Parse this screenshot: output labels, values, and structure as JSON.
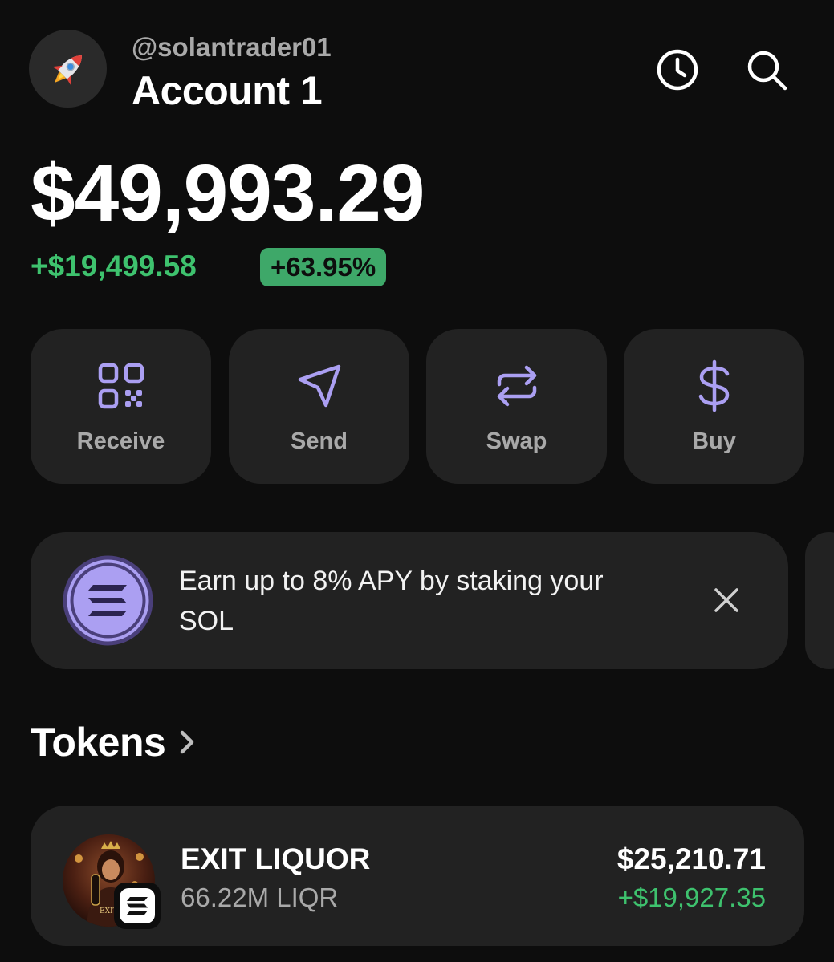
{
  "account": {
    "username": "@solantrader01",
    "name": "Account 1",
    "avatar_icon": "rocket-icon"
  },
  "header_icons": [
    "history-clock-icon",
    "search-icon"
  ],
  "balance": {
    "total": "$49,993.29",
    "change_amount": "+$19,499.58",
    "change_percent": "+63.95%"
  },
  "actions": [
    {
      "label": "Receive",
      "icon": "qr-code-icon"
    },
    {
      "label": "Send",
      "icon": "send-arrow-icon"
    },
    {
      "label": "Swap",
      "icon": "swap-arrows-icon"
    },
    {
      "label": "Buy",
      "icon": "dollar-icon"
    }
  ],
  "promo": {
    "text": "Earn up to 8% APY by staking your SOL",
    "icon": "solana-logo-icon"
  },
  "tokens": {
    "title": "Tokens",
    "items": [
      {
        "name": "EXIT LIQUOR",
        "amount": "66.22M LIQR",
        "value": "$25,210.71",
        "change": "+$19,927.35"
      }
    ]
  },
  "colors": {
    "background": "#0d0d0d",
    "card": "#222222",
    "accent_purple": "#ab9ff2",
    "positive_green": "#3ec26e"
  }
}
